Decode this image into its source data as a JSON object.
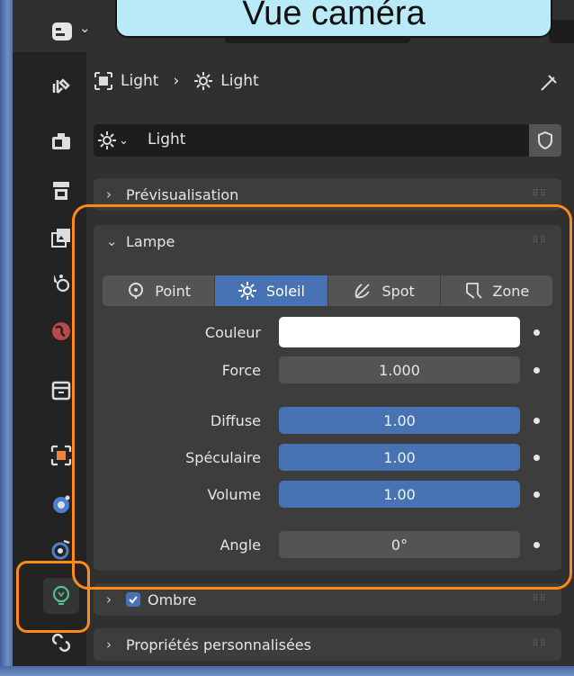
{
  "callout": {
    "text": "Vue caméra"
  },
  "breadcrumb": {
    "object": "Light",
    "separator": "›",
    "data": "Light"
  },
  "datablock": {
    "name": "Light"
  },
  "panels": {
    "preview": {
      "title": "Prévisualisation"
    },
    "lamp": {
      "title": "Lampe"
    },
    "shadow": {
      "title": "Ombre",
      "checked": true
    },
    "custom": {
      "title": "Propriétés personnalisées"
    }
  },
  "light_types": [
    {
      "label": "Point",
      "icon": "point-light-icon",
      "active": false
    },
    {
      "label": "Soleil",
      "icon": "sun-light-icon",
      "active": true
    },
    {
      "label": "Spot",
      "icon": "spot-light-icon",
      "active": false
    },
    {
      "label": "Zone",
      "icon": "area-light-icon",
      "active": false
    }
  ],
  "properties": {
    "color": {
      "label": "Couleur",
      "value": "#ffffff"
    },
    "strength": {
      "label": "Force",
      "value": "1.000"
    },
    "diffuse": {
      "label": "Diffuse",
      "value": "1.00"
    },
    "specular": {
      "label": "Spéculaire",
      "value": "1.00"
    },
    "volume": {
      "label": "Volume",
      "value": "1.00"
    },
    "angle": {
      "label": "Angle",
      "value": "0°"
    }
  },
  "colors": {
    "accent": "#4772b3",
    "highlight": "#ff8a1a",
    "panel": "#3d3d3d",
    "background": "#303030"
  },
  "sidebar_tabs": [
    "tool-icon",
    "render-icon",
    "output-icon",
    "view-layer-icon",
    "scene-icon",
    "world-icon",
    "collection-icon",
    "object-icon",
    "modifier-icon",
    "physics-icon",
    "light-data-icon",
    "constraint-icon"
  ]
}
